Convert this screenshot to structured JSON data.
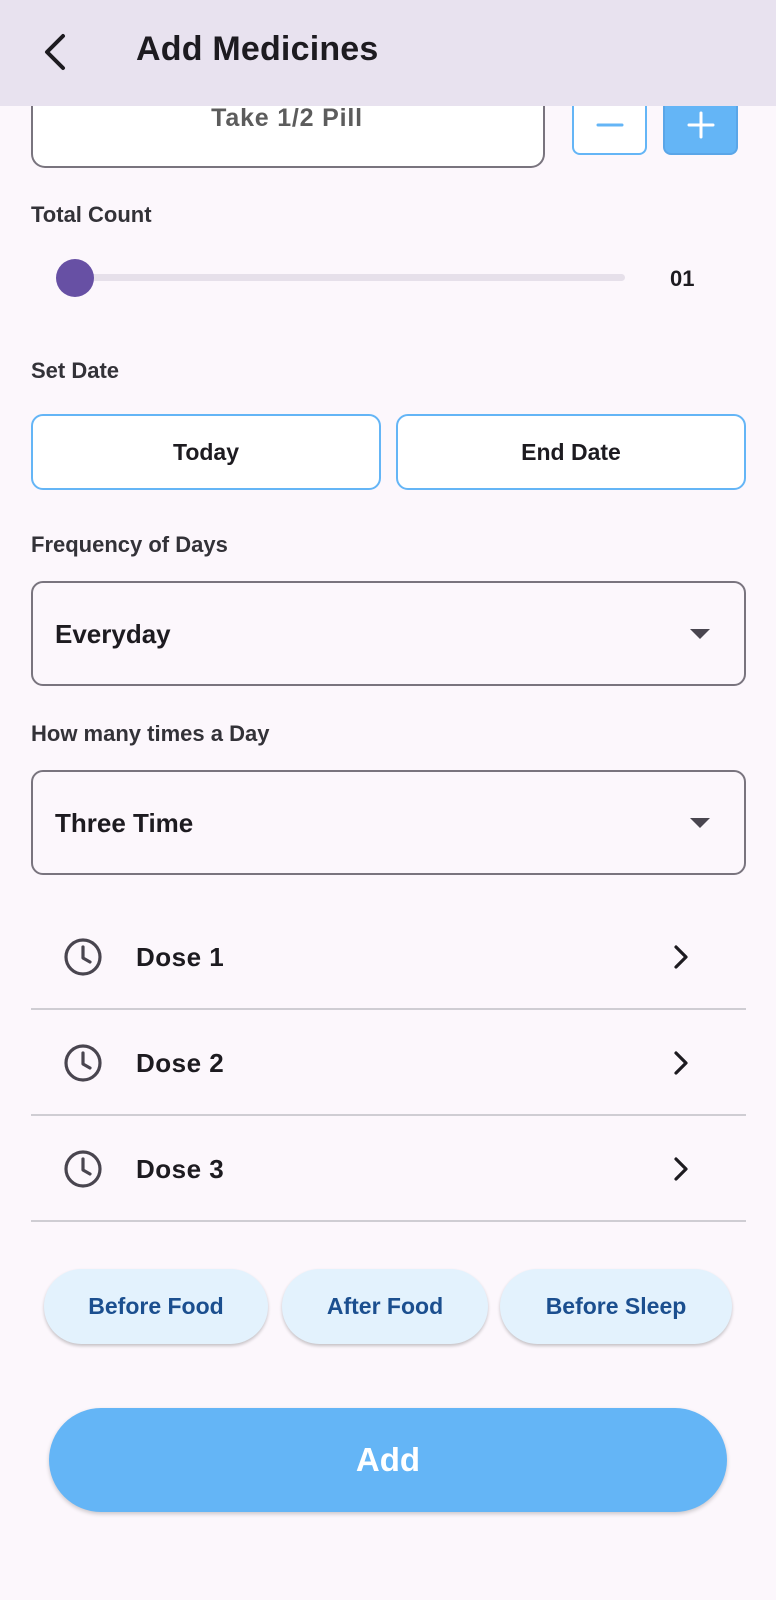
{
  "appbar": {
    "title": "Add Medicines",
    "back_icon": "arrow-back-icon"
  },
  "pill": {
    "text": "Take 1/2 Pill",
    "minus_icon": "minus-icon",
    "plus_icon": "plus-icon"
  },
  "total_count": {
    "label": "Total Count",
    "value": "01",
    "slider_fraction": 0.0
  },
  "set_date": {
    "label": "Set Date",
    "start_label": "Today",
    "end_label": "End Date"
  },
  "frequency": {
    "label": "Frequency of Days",
    "selected": "Everyday"
  },
  "times_per_day": {
    "label": "How many times a Day",
    "selected": "Three Time"
  },
  "doses": [
    {
      "label": "Dose 1",
      "icon": "clock-icon"
    },
    {
      "label": "Dose 2",
      "icon": "clock-icon"
    },
    {
      "label": "Dose 3",
      "icon": "clock-icon"
    }
  ],
  "timing_chips": [
    "Before Food",
    "After Food",
    "Before Sleep"
  ],
  "submit": {
    "label": "Add"
  },
  "colors": {
    "accent": "#64b5f6",
    "slider_thumb": "#6750a4",
    "appbar_bg": "#e8e2ef",
    "chip_bg": "#e3f2fd",
    "chip_text": "#1b4f8f"
  }
}
